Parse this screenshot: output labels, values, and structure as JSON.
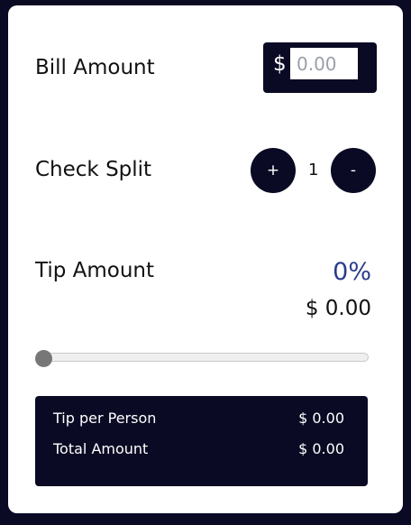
{
  "bill": {
    "label": "Bill Amount",
    "currency_symbol": "$",
    "placeholder": "0.00",
    "value": ""
  },
  "split": {
    "label": "Check Split",
    "increment_label": "+",
    "count": "1",
    "decrement_label": "-"
  },
  "tip": {
    "label": "Tip Amount",
    "percent": "0%",
    "amount": "$ 0.00",
    "slider_value": 0
  },
  "summary": {
    "rows": [
      {
        "label": "Tip per Person",
        "value": "$ 0.00"
      },
      {
        "label": "Total Amount",
        "value": "$ 0.00"
      }
    ]
  },
  "colors": {
    "background": "#0a0a24",
    "card": "#ffffff",
    "accent_percent": "#2a3d8a"
  }
}
